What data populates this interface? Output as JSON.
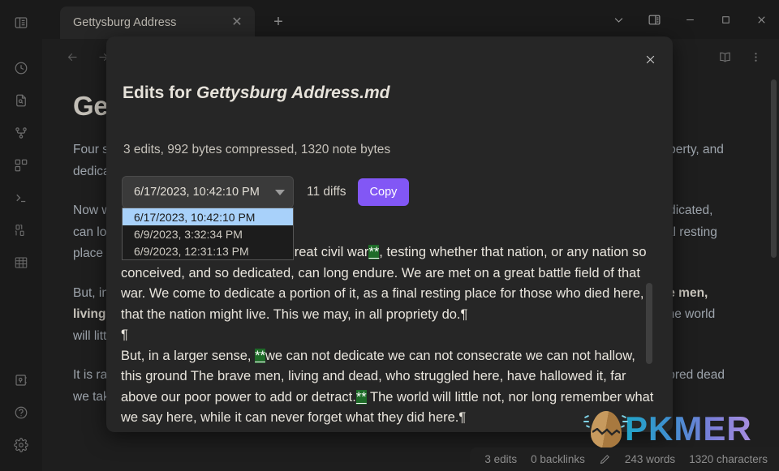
{
  "window": {
    "controls": [
      {
        "name": "chevron-down-icon",
        "label": "More"
      },
      {
        "name": "right-sidebar-toggle-icon",
        "label": "Toggle right sidebar"
      },
      {
        "name": "minimize-icon",
        "label": "Minimize"
      },
      {
        "name": "maximize-icon",
        "label": "Maximize"
      },
      {
        "name": "close-icon",
        "label": "Close"
      }
    ]
  },
  "tab": {
    "title": "Gettysburg Address",
    "close_label": "✕",
    "new_tab_label": "+"
  },
  "ribbon": {
    "items": [
      {
        "name": "clock-history-icon",
        "label": "File recovery history"
      },
      {
        "name": "file-search-icon",
        "label": "Search in file"
      },
      {
        "name": "git-graph-icon",
        "label": "Version graph"
      },
      {
        "name": "blocks-grid-icon",
        "label": "Canvas"
      },
      {
        "name": "terminal-icon",
        "label": "Shell commands"
      },
      {
        "name": "binary-icon",
        "label": "Binary"
      },
      {
        "name": "table-icon",
        "label": "Table"
      }
    ],
    "bottom_items": [
      {
        "name": "vault-icon",
        "label": "Open another vault"
      },
      {
        "name": "help-icon",
        "label": "Help"
      },
      {
        "name": "settings-gear-icon",
        "label": "Settings"
      }
    ]
  },
  "toolbar": {
    "back_label": "←",
    "forward_label": "→",
    "reading_view": "book-icon",
    "more_options": "vertical-dots-icon"
  },
  "document": {
    "title": "Gettysburg Address",
    "paragraphs": [
      {
        "text": "Four score and seven years ago our fathers brought forth, upon this continent, a new nation, conceived in liberty, and dedicated to the proposition that all men are created equal."
      },
      {
        "text": "Now we are engaged in a great civil war, testing whether that nation, or any nation so conceived, and so dedicated, can long endure. We are met on a great battle field of that war. We come to dedicate a portion of it, as a final resting place for those who died here, that the nation might live. This we may, in all propriety do."
      },
      {
        "text": "But, in a larger sense, we can not dedicate we can not consecrate we can not hallow, this ground The brave men, living and dead, who struggled here, have hallowed it, far above our poor power to add or detract. The world will little not, nor long remember what we say here, while it can never forget what they did here."
      },
      {
        "text": "It is rather for us, the living, we here be dedicated to the great task remaining before us that from these honored dead we take increased devotion to that cause for whi"
      }
    ]
  },
  "modal": {
    "title_prefix": "Edits for ",
    "title_file": "Gettysburg Address.md",
    "close_label": "✕",
    "stats": "3 edits, 992 bytes compressed, 1320 note bytes",
    "selected_version": "6/17/2023, 10:42:10 PM",
    "diff_count": "11 diffs",
    "copy_label": "Copy",
    "versions": [
      "6/17/2023, 10:42:10 PM",
      "6/9/2023, 3:32:34 PM",
      "6/9/2023, 12:31:13 PM"
    ],
    "diff": {
      "para1": {
        "pre": "Now we are engaged in a ",
        "mark1": "**",
        "mid": "great civil war",
        "mark2": "**",
        "post": ", testing whether that nation, or any nation so conceived, and so dedicated, can long endure. We are met on a great battle field of that war. We come to dedicate a portion of it, as a final resting place for those who died here, that the nation might live. This we may, in all propriety do.",
        "pilcrow": "¶"
      },
      "blank_pilcrow": "¶",
      "para2": {
        "pre": "But, in a larger sense, ",
        "mark1": "**",
        "mid": "we can not dedicate we can not consecrate we can not hallow, this ground The brave men, living and dead, who struggled here, have hallowed it, far above our poor power to add or detract.",
        "mark2": "**",
        "post": " The world will little not, nor long remember what we say here, while it can never forget what they did here.",
        "pilcrow": "¶"
      }
    },
    "colors": {
      "accent": "#8257f5",
      "highlight_green": "#1e6b28",
      "selected_option": "#a8d1fa"
    }
  },
  "watermark": {
    "text": "PKMER"
  },
  "statusbar": {
    "edits": "3 edits",
    "backlinks": "0 backlinks",
    "pencil_icon": "pencil-icon",
    "words": "243 words",
    "characters": "1320 characters"
  }
}
